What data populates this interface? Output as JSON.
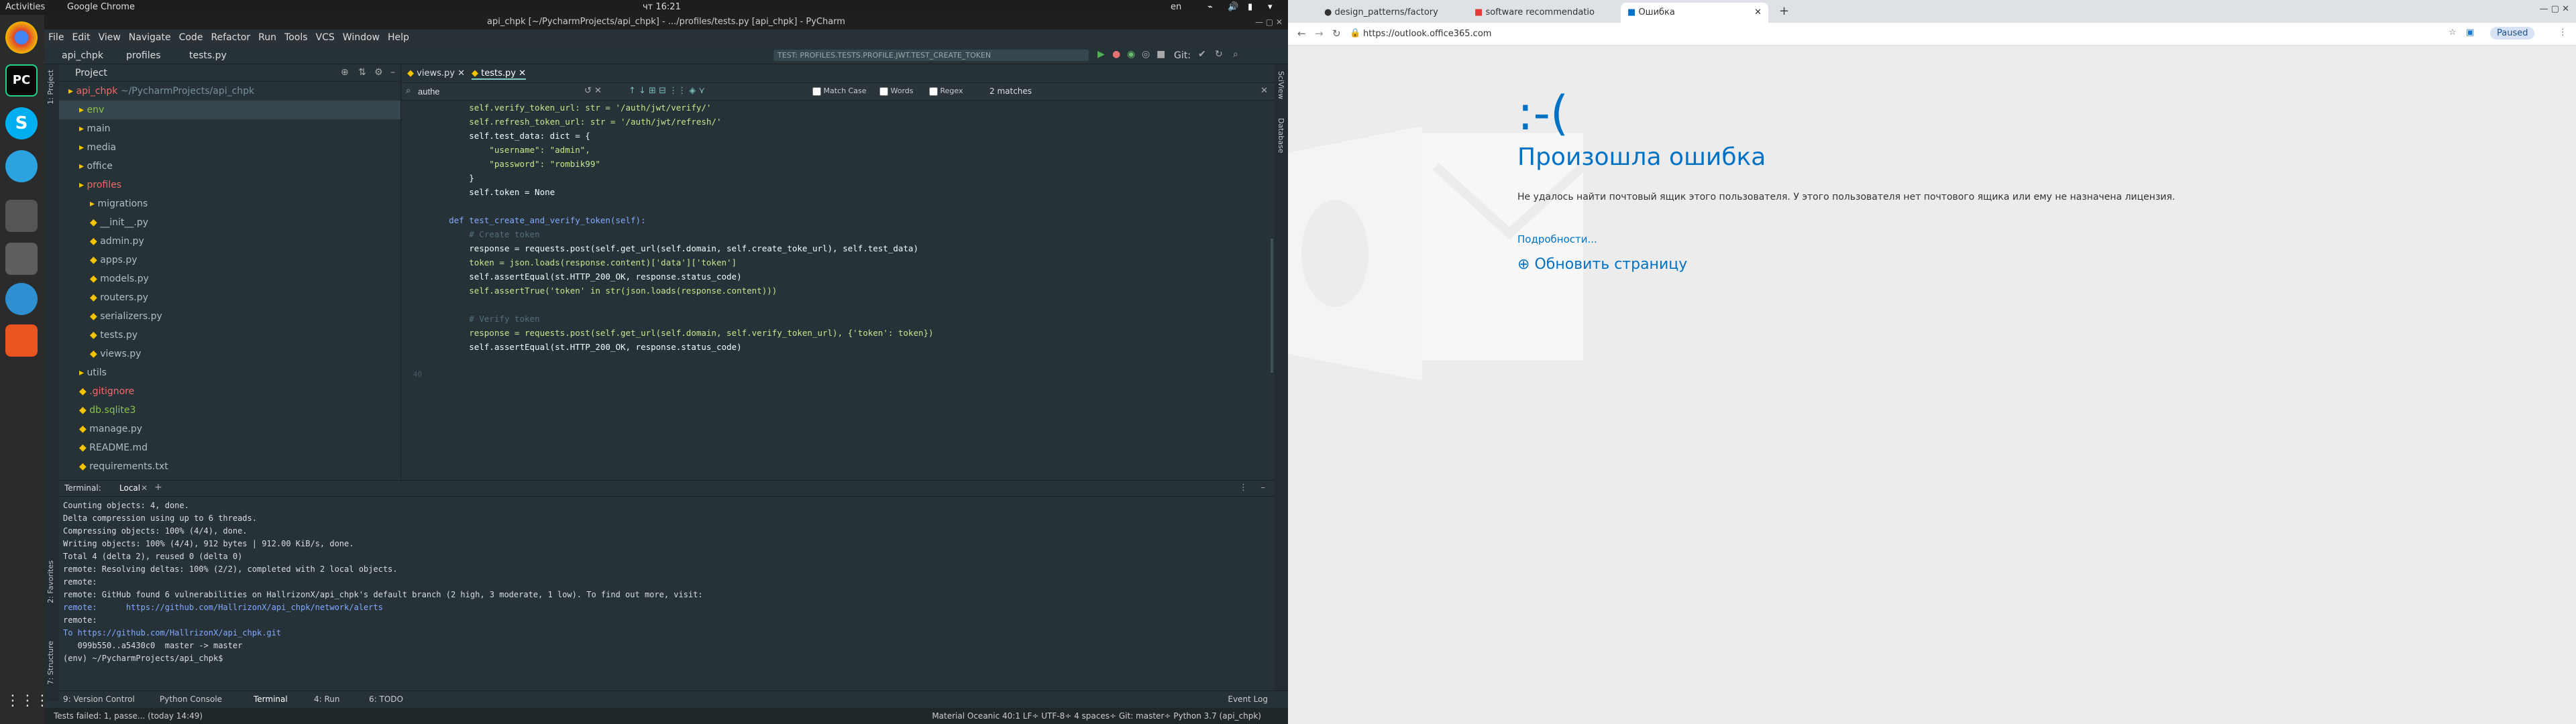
{
  "topbar": {
    "activities": "Activities",
    "app": "Google Chrome",
    "clock": "чт 16:21",
    "lang": "en"
  },
  "ide": {
    "title": "api_chpk [~/PycharmProjects/api_chpk] - .../profiles/tests.py [api_chpk] - PyCharm",
    "menu": [
      "File",
      "Edit",
      "View",
      "Navigate",
      "Code",
      "Refactor",
      "Run",
      "Tools",
      "VCS",
      "Window",
      "Help"
    ],
    "breadcrumb": [
      "api_chpk",
      "profiles",
      "tests.py"
    ],
    "run_config": "TEST: PROFILES.TESTS.PROFILE.JWT.TEST_CREATE_TOKEN",
    "git_label": "Git:",
    "project_label": "Project",
    "tree": [
      {
        "name": "api_chpk",
        "extra": "~/PycharmProjects/api_chpk",
        "indent": 0,
        "color": "#f06a6a"
      },
      {
        "name": "env",
        "extra": "",
        "indent": 1,
        "color": "#8bc34a"
      },
      {
        "name": "main",
        "extra": "",
        "indent": 1,
        "color": "#b0bec5"
      },
      {
        "name": "media",
        "extra": "",
        "indent": 1,
        "color": "#b0bec5"
      },
      {
        "name": "office",
        "extra": "",
        "indent": 1,
        "color": "#b0bec5"
      },
      {
        "name": "profiles",
        "extra": "",
        "indent": 1,
        "color": "#f06a6a"
      },
      {
        "name": "migrations",
        "extra": "",
        "indent": 2,
        "color": "#b0bec5"
      },
      {
        "name": "__init__.py",
        "extra": "",
        "indent": 2,
        "color": "#b0bec5"
      },
      {
        "name": "admin.py",
        "extra": "",
        "indent": 2,
        "color": "#b0bec5"
      },
      {
        "name": "apps.py",
        "extra": "",
        "indent": 2,
        "color": "#b0bec5"
      },
      {
        "name": "models.py",
        "extra": "",
        "indent": 2,
        "color": "#b0bec5"
      },
      {
        "name": "routers.py",
        "extra": "",
        "indent": 2,
        "color": "#b0bec5"
      },
      {
        "name": "serializers.py",
        "extra": "",
        "indent": 2,
        "color": "#b0bec5"
      },
      {
        "name": "tests.py",
        "extra": "",
        "indent": 2,
        "color": "#b0bec5"
      },
      {
        "name": "views.py",
        "extra": "",
        "indent": 2,
        "color": "#b0bec5"
      },
      {
        "name": "utils",
        "extra": "",
        "indent": 1,
        "color": "#b0bec5"
      },
      {
        "name": ".gitignore",
        "extra": "",
        "indent": 1,
        "color": "#f06a6a"
      },
      {
        "name": "db.sqlite3",
        "extra": "",
        "indent": 1,
        "color": "#8bc34a"
      },
      {
        "name": "manage.py",
        "extra": "",
        "indent": 1,
        "color": "#b0bec5"
      },
      {
        "name": "README.md",
        "extra": "",
        "indent": 1,
        "color": "#b0bec5"
      },
      {
        "name": "requirements.txt",
        "extra": "",
        "indent": 1,
        "color": "#b0bec5"
      }
    ],
    "editor_tabs": [
      "views.py",
      "tests.py"
    ],
    "find": {
      "query": "authe",
      "match_case": "Match Case",
      "words": "Words",
      "regex": "Regex",
      "matches": "2 matches"
    },
    "code": [
      {
        "n": "",
        "t": "        self.verify_token_url: str = '/auth/jwt/verify/'"
      },
      {
        "n": "",
        "t": "        self.refresh_token_url: str = '/auth/jwt/refresh/'"
      },
      {
        "n": "",
        "t": "        self.test_data: dict = {"
      },
      {
        "n": "",
        "t": "            \"username\": \"admin\","
      },
      {
        "n": "",
        "t": "            \"password\": \"rombik99\""
      },
      {
        "n": "",
        "t": "        }"
      },
      {
        "n": "",
        "t": "        self.token = None"
      },
      {
        "n": "",
        "t": ""
      },
      {
        "n": "",
        "t": "    def test_create_and_verify_token(self):"
      },
      {
        "n": "",
        "t": "        # Create token"
      },
      {
        "n": "",
        "t": "        response = requests.post(self.get_url(self.domain, self.create_toke_url), self.test_data)"
      },
      {
        "n": "",
        "t": "        token = json.loads(response.content)['data']['token']"
      },
      {
        "n": "",
        "t": "        self.assertEqual(st.HTTP_200_OK, response.status_code)"
      },
      {
        "n": "",
        "t": "        self.assertTrue('token' in str(json.loads(response.content)))"
      },
      {
        "n": "",
        "t": ""
      },
      {
        "n": "",
        "t": "        # Verify token"
      },
      {
        "n": "",
        "t": "        response = requests.post(self.get_url(self.domain, self.verify_token_url), {'token': token})"
      },
      {
        "n": "",
        "t": "        self.assertEqual(st.HTTP_200_OK, response.status_code)"
      },
      {
        "n": "",
        "t": ""
      },
      {
        "n": "40",
        "t": ""
      }
    ],
    "terminal_label": "Terminal:",
    "terminal_tab": "Local",
    "terminal": [
      "Counting objects: 4, done.",
      "Delta compression using up to 6 threads.",
      "Compressing objects: 100% (4/4), done.",
      "Writing objects: 100% (4/4), 912 bytes | 912.00 KiB/s, done.",
      "Total 4 (delta 2), reused 0 (delta 0)",
      "remote: Resolving deltas: 100% (2/2), completed with 2 local objects.",
      "remote:",
      "remote: GitHub found 6 vulnerabilities on HallrizonX/api_chpk's default branch (2 high, 3 moderate, 1 low). To find out more, visit:",
      "remote:      https://github.com/HallrizonX/api_chpk/network/alerts",
      "remote:",
      "To https://github.com/HallrizonX/api_chpk.git",
      "   099b550..a5430c0  master -> master",
      "(env) ~/PycharmProjects/api_chpk$ "
    ],
    "bottom_tabs": [
      "9: Version Control",
      "Python Console",
      "Terminal",
      "4: Run",
      "6: TODO"
    ],
    "event_log": "Event Log",
    "status_left": "Tests failed: 1, passe... (today 14:49)",
    "status_right": "Material Oceanic   40:1   LF÷   UTF-8÷   4 spaces÷   Git: master÷   Python 3.7 (api_chpk)",
    "left_tabs": [
      "1: Project",
      "2: Favorites",
      "7: Structure"
    ],
    "right_tabs": [
      "SciView",
      "Database"
    ]
  },
  "chrome": {
    "tabs": [
      "design_patterns/factory",
      "software recommendatio",
      "Ошибка"
    ],
    "url": "https://outlook.office365.com",
    "paused": "Paused",
    "sad": ":-(",
    "heading": "Произошла ошибка",
    "message": "Не удалось найти почтовый ящик этого пользователя. У этого пользователя нет почтового ящика или ему не назначена лицензия.",
    "details": "Подробности...",
    "refresh": "Обновить страницу"
  }
}
